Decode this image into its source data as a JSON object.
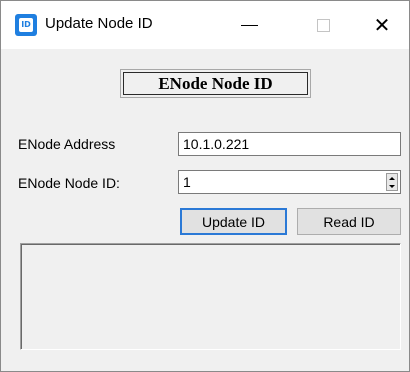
{
  "window": {
    "title": "Update Node ID",
    "icon": "app-id-icon",
    "controls": {
      "minimize": "minimize-icon",
      "maximize": "maximize-icon",
      "close": "close-icon"
    }
  },
  "heading": "ENode Node ID",
  "form": {
    "address_label": "ENode Address",
    "address_value": "10.1.0.221",
    "node_id_label": "ENode Node ID:",
    "node_id_value": "1"
  },
  "buttons": {
    "update": "Update ID",
    "read": "Read ID"
  },
  "output": {
    "text": ""
  },
  "colors": {
    "accent": "#2b79d6",
    "window_bg": "#f0f0f0",
    "icon": "#1f7fe0"
  }
}
